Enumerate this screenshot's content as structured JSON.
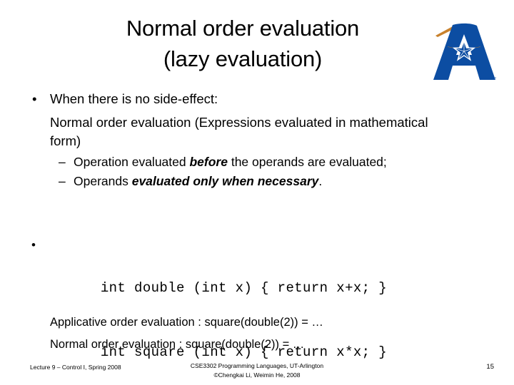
{
  "slide": {
    "title_lines": [
      "Normal order evaluation",
      "(lazy evaluation)"
    ],
    "logo": {
      "name": "uta-a-star-logo",
      "trademark": "™",
      "blue": "#0C4DA2",
      "accent": "#C8812C"
    }
  },
  "body": {
    "bullet_glyph": "•",
    "dash_glyph": "–",
    "bullet1_text": "When there is no side-effect:",
    "paragraph": "Normal order evaluation (Expressions evaluated in mathematical form)",
    "sub_bullets": [
      {
        "pre": "Operation evaluated ",
        "emph": "before",
        "post": " the operands are evaluated;"
      },
      {
        "pre": "Operands ",
        "emph": "evaluated only when necessary",
        "post": "."
      }
    ]
  },
  "code": {
    "bullet_glyph": "•",
    "lines": [
      "int double (int x) { return x+x; }",
      "int square (int x) { return x*x; }"
    ]
  },
  "examples": {
    "lines": [
      "Applicative order evaluation : square(double(2)) =  …",
      "Normal order evaluation : square(double(2)) = …"
    ]
  },
  "footer": {
    "left": "Lecture 9 – Control I, Spring 2008",
    "center_line1": "CSE3302 Programming Languages, UT-Arlington",
    "center_line2": "©Chengkai Li, Weimin He, 2008",
    "page": "15"
  }
}
